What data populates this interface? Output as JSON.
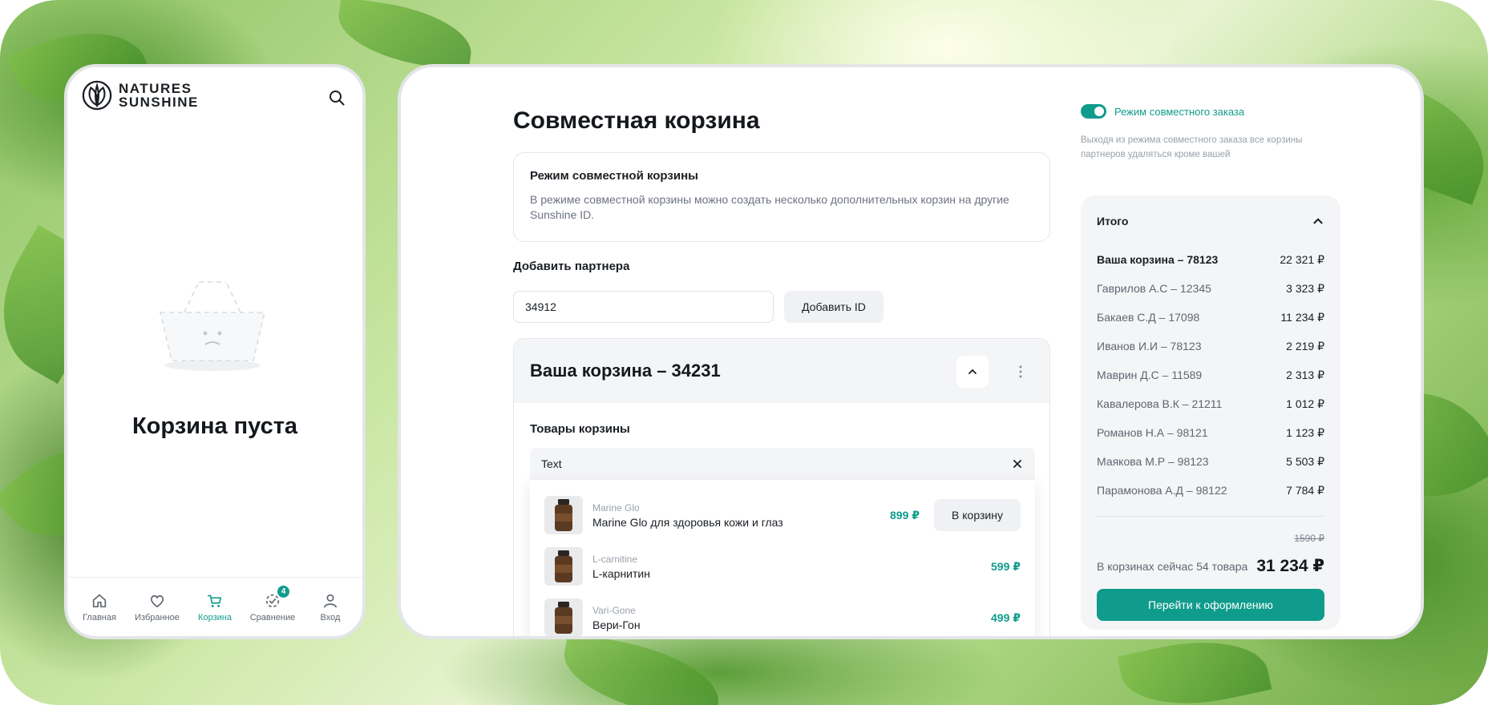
{
  "colors": {
    "accent": "#109c8c",
    "panel": "#f4f5f7",
    "muted": "#9aa1a9"
  },
  "mobile": {
    "brand": {
      "line1": "NATURES",
      "line2": "SUNSHINE",
      "icon": "brand-leaf-icon"
    },
    "search_icon": "search-icon",
    "empty_title": "Корзина пуста",
    "tabs": [
      {
        "label": "Главная",
        "icon": "home-icon",
        "active": false
      },
      {
        "label": "Избранное",
        "icon": "heart-icon",
        "active": false
      },
      {
        "label": "Корзина",
        "icon": "cart-icon",
        "active": true
      },
      {
        "label": "Сравнение",
        "icon": "compare-icon",
        "active": false,
        "badge": "4"
      },
      {
        "label": "Вход",
        "icon": "user-icon",
        "active": false
      }
    ]
  },
  "desktop": {
    "title": "Совместная корзина",
    "info": {
      "title": "Режим совместной корзины",
      "text": "В режиме совместной корзины можно создать несколько дополнительных корзин на другие Sunshine ID."
    },
    "add_partner": {
      "label": "Добавить партнера",
      "input_value": "34912",
      "button": "Добавить ID"
    },
    "cart": {
      "title": "Ваша корзина – 34231",
      "goods_label": "Товары корзины",
      "search_value": "Text",
      "products": [
        {
          "brand": "Marine Glo",
          "name": "Marine Glo для здоровья кожи и глаз",
          "price": "899 ₽",
          "button": "В корзину"
        },
        {
          "brand": "L-carnitine",
          "name": "L-карнитин",
          "price": "599 ₽"
        },
        {
          "brand": "Vari-Gone",
          "name": "Вери-Гон",
          "price": "499 ₽"
        }
      ]
    },
    "joint_mode": {
      "label": "Режим совместного заказа",
      "enabled": true,
      "hint": "Выходя из режима совместного заказа все корзины партнеров удаляться кроме вашей"
    },
    "summary": {
      "title": "Итого",
      "items": [
        {
          "name": "Ваша корзина – 78123",
          "amount": "22 321 ₽",
          "own": true
        },
        {
          "name": "Гаврилов А.С – 12345",
          "amount": "3 323 ₽"
        },
        {
          "name": "Бакаев С.Д – 17098",
          "amount": "11 234 ₽"
        },
        {
          "name": "Иванов И.И – 78123",
          "amount": "2 219 ₽"
        },
        {
          "name": "Маврин Д.С – 11589",
          "amount": "2 313 ₽"
        },
        {
          "name": "Кавалерова В.К – 21211",
          "amount": "1 012 ₽"
        },
        {
          "name": "Романов Н.А – 98121",
          "amount": "1 123 ₽"
        },
        {
          "name": "Маякова М.Р – 98123",
          "amount": "5 503 ₽"
        },
        {
          "name": "Парамонова А.Д – 98122",
          "amount": "7 784 ₽"
        }
      ],
      "old_price": "1590 ₽",
      "count_text": "В корзинах сейчас 54 товара",
      "total": "31 234 ₽",
      "checkout": "Перейти к оформлению"
    }
  }
}
